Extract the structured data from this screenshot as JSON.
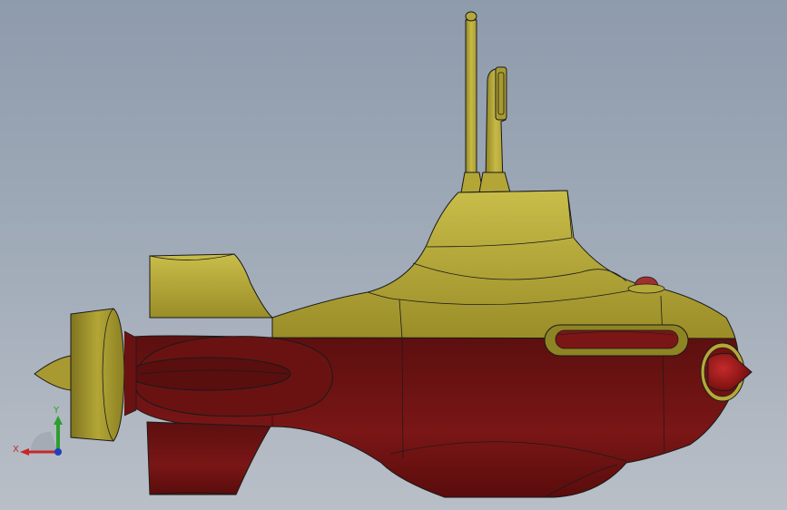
{
  "viewport": {
    "background_top": "#8e9bac",
    "background_bottom": "#b9bfc7"
  },
  "model": {
    "name": "submarine",
    "upper_hull_color": "#b5a83a",
    "lower_hull_color": "#6e1212",
    "propeller_color": "#a89a30",
    "nose_cone_color": "#8a1010",
    "edge_color": "#1a1a1a"
  },
  "triad": {
    "x_label": "X",
    "y_label": "Y",
    "x_color": "#c62828",
    "y_color": "#2e9e2e",
    "z_color": "#1f3fbf"
  }
}
